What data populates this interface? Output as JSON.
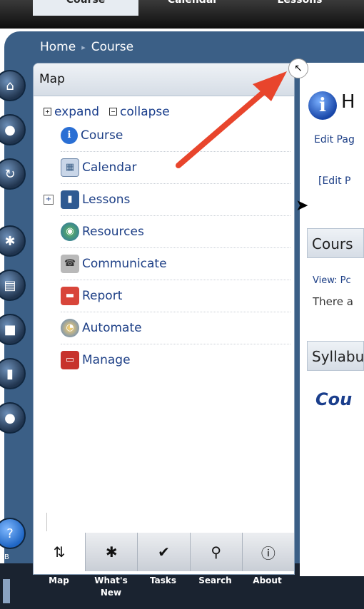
{
  "top_tabs": [
    "Course",
    "Calendar",
    "Lessons"
  ],
  "breadcrumb": {
    "home": "Home",
    "separator": "▸",
    "current": "Course"
  },
  "map": {
    "title": "Map",
    "expand_label": "expand",
    "collapse_label": "collapse",
    "items": [
      {
        "label": "Course",
        "icon": "info-icon"
      },
      {
        "label": "Calendar",
        "icon": "calendar-icon"
      },
      {
        "label": "Lessons",
        "icon": "lessons-icon",
        "expandable": true
      },
      {
        "label": "Resources",
        "icon": "globe-icon"
      },
      {
        "label": "Communicate",
        "icon": "phone-icon"
      },
      {
        "label": "Report",
        "icon": "report-icon"
      },
      {
        "label": "Automate",
        "icon": "clock-icon"
      },
      {
        "label": "Manage",
        "icon": "toolbox-icon"
      }
    ]
  },
  "toolbar": {
    "buttons": [
      {
        "label": "Map",
        "icon": "map-pin-icon",
        "glyph": "⇅",
        "active": true
      },
      {
        "label": "What's New",
        "icon": "whats-new-icon",
        "glyph": "✱"
      },
      {
        "label": "Tasks",
        "icon": "check-icon",
        "glyph": "✔"
      },
      {
        "label": "Search",
        "icon": "search-icon",
        "glyph": "⚲"
      },
      {
        "label": "About",
        "icon": "about-icon",
        "glyph": "ⓘ"
      }
    ]
  },
  "content": {
    "heading": "H",
    "edit_page": "Edit Pag",
    "edit_link": "[Edit P",
    "box1_title": "Cours",
    "box1_line1": "View: Pc",
    "box1_line2": "There a",
    "box2_title": "Syllabu",
    "course_text": "Cou"
  },
  "rail_caption": "B",
  "colors": {
    "frame": "#3b5f86",
    "link": "#1d3f86",
    "arrow": "#e8452c"
  }
}
